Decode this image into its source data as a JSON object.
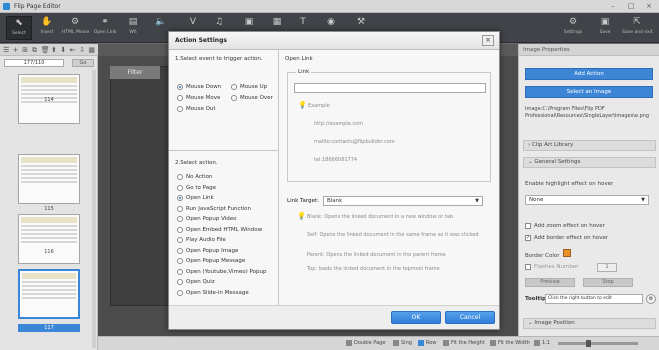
{
  "app": {
    "title": "Flip Page Editor"
  },
  "toolbar": {
    "items": [
      {
        "label": "Select",
        "icon": "cursor-icon",
        "glyph": "⬉"
      },
      {
        "label": "Insert",
        "icon": "hand-icon",
        "glyph": "✋"
      },
      {
        "label": "HTML Movie",
        "icon": "globe-icon",
        "glyph": "⚙"
      },
      {
        "label": "Open Link",
        "icon": "link-icon",
        "glyph": "⚭"
      },
      {
        "label": "Wh",
        "icon": "page-icon",
        "glyph": "▤"
      },
      {
        "label": "",
        "icon": "speaker-icon",
        "glyph": "🔈"
      },
      {
        "label": "",
        "icon": "video-icon",
        "glyph": "V"
      },
      {
        "label": "",
        "icon": "music-icon",
        "glyph": "♫"
      },
      {
        "label": "",
        "icon": "image-icon",
        "glyph": "▣"
      },
      {
        "label": "",
        "icon": "slideshow-icon",
        "glyph": "▦"
      },
      {
        "label": "",
        "icon": "text-icon",
        "glyph": "T"
      },
      {
        "label": "",
        "icon": "shape-icon",
        "glyph": "◉"
      },
      {
        "label": "",
        "icon": "tool-icon",
        "glyph": "⚒"
      }
    ],
    "right": [
      {
        "label": "Settings",
        "icon": "gear-icon",
        "glyph": "⚙"
      },
      {
        "label": "Save",
        "icon": "save-icon",
        "glyph": "▣"
      },
      {
        "label": "Save and exit",
        "icon": "save-exit-icon",
        "glyph": "⇱"
      }
    ]
  },
  "left": {
    "page_counter": "177/110",
    "page_btn": "Go",
    "thumbs": [
      {
        "label": "114"
      },
      {
        "label": "115"
      },
      {
        "label": "116"
      },
      {
        "label": "117"
      }
    ]
  },
  "canvas": {
    "filter_tab": "Filter"
  },
  "status": {
    "double_page": "Double Page",
    "single": "Sing",
    "row": "Row",
    "fit_height": "Fit the Height",
    "fit_width": "Fit the Width",
    "zoom": "1:1"
  },
  "right_panel": {
    "title": "Image Properties",
    "add_action": "Add Action",
    "select_image": "Select an Image",
    "path": "Image:C:\\Program Files\\Flip PDF Professional\\Resources\\SingleLayer\\Images\\e.png",
    "clip_art": "Clip Art Library",
    "general_settings": "General Settings",
    "hover_label": "Enable highlight effect on hover",
    "hover_value": "None",
    "zoom_effect": "Add zoom effect on hover",
    "border_effect": "Add border effect on hover",
    "border_color": "Border Color",
    "flashes_number": "Flashes Number",
    "flashes_value": "1",
    "preview": "Preview",
    "stop": "Stop",
    "tooltip_label": "Tooltip",
    "tooltip_value": "Click the right button to edit",
    "image_position": "Image Position"
  },
  "dialog": {
    "title": "Action Settings",
    "step1": "1.Select event to trigger action.",
    "events": [
      {
        "label": "Mouse Down",
        "checked": true
      },
      {
        "label": "Mouse Up",
        "checked": false
      },
      {
        "label": "Mouse Move",
        "checked": false
      },
      {
        "label": "Mouse Over",
        "checked": false
      },
      {
        "label": "Mouse Out",
        "checked": false
      }
    ],
    "step2": "2.Select action.",
    "actions": [
      {
        "label": "No Action",
        "checked": false
      },
      {
        "label": "Go to Page",
        "checked": false
      },
      {
        "label": "Open Link",
        "checked": true
      },
      {
        "label": "Run JavaScript Function",
        "checked": false
      },
      {
        "label": "Open Popup Video",
        "checked": false
      },
      {
        "label": "Open Embed HTML Window",
        "checked": false
      },
      {
        "label": "Play Audio File",
        "checked": false
      },
      {
        "label": "Open Popup Image",
        "checked": false
      },
      {
        "label": "Open Popup Message",
        "checked": false
      },
      {
        "label": "Open (Youtube,Vimeo) Popup",
        "checked": false
      },
      {
        "label": "Open Quiz",
        "checked": false
      },
      {
        "label": "Open Slide-in Message",
        "checked": false
      }
    ],
    "right_header": "Open Link",
    "link_legend": "Link",
    "link_value": "",
    "example_title": "Example",
    "example_lines": [
      "http://example.com",
      "mailto:contacts@flipbuilder.com",
      "tel:18666081774"
    ],
    "link_target_label": "Link Target:",
    "link_target_value": "Blank",
    "help_blank": "Blank: Opens the linked document in a new window or tab",
    "help_self": "Self: Opens the linked document in the same frame as it was clicked",
    "help_parent": "Parent: Opens the linked document in the parent frame",
    "help_top": "Top: loads the linked document in the topmost frame",
    "ok": "OK",
    "cancel": "Cancel",
    "close": "×"
  }
}
